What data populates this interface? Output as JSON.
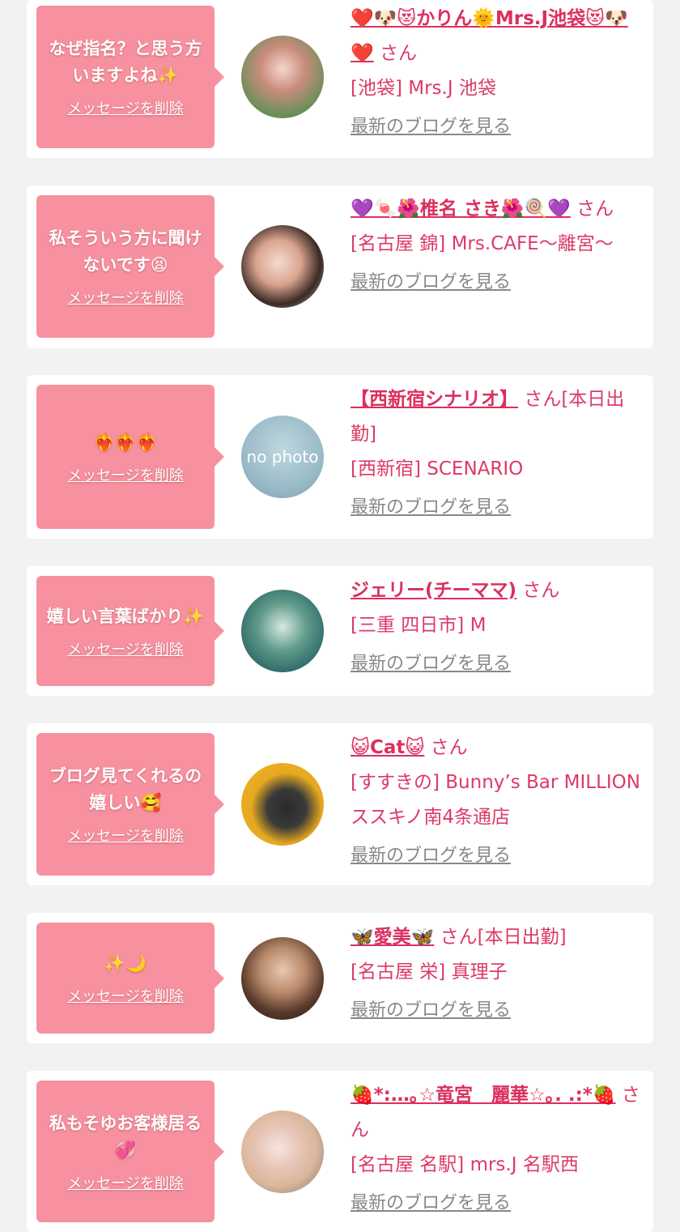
{
  "cards": [
    {
      "message": "なぜ指名？と思う方いますよね✨",
      "delete_label": "メッセージを削除",
      "name": "❤️🐶😻かりん🌞Mrs.J池袋😻🐶❤️",
      "san": "さん",
      "shop": "[池袋] Mrs.J 池袋",
      "blog_label": "最新のブログを見る"
    },
    {
      "message": "私そういう方に聞けないです😫",
      "delete_label": "メッセージを削除",
      "name": "💜🍬🌺椎名 さき🌺🍭💜",
      "san": "さん",
      "shop": "[名古屋 錦] Mrs.CAFE〜離宮〜",
      "blog_label": "最新のブログを見る"
    },
    {
      "message": "❤️‍🔥❤️‍🔥❤️‍🔥",
      "delete_label": "メッセージを削除",
      "name": "【西新宿シナリオ】",
      "san": "さん[本日出勤]",
      "shop": "[西新宿] SCENARIO",
      "blog_label": "最新のブログを見る",
      "avatar_text": "no photo"
    },
    {
      "message": "嬉しい言葉ばかり✨",
      "delete_label": "メッセージを削除",
      "name": "ジェリー(チーママ)",
      "san": "さん",
      "shop": "[三重 四日市] M",
      "blog_label": "最新のブログを見る"
    },
    {
      "message": "ブログ見てくれるの嬉しい🥰",
      "delete_label": "メッセージを削除",
      "name": "😺Cat😺",
      "san": "さん",
      "shop": "[すすきの] Bunny’s Bar MILLION ススキノ南4条通店",
      "blog_label": "最新のブログを見る"
    },
    {
      "message": "✨🌙",
      "delete_label": "メッセージを削除",
      "name": "🦋愛美🦋",
      "san": "さん[本日出勤]",
      "shop": "[名古屋 栄] 真理子",
      "blog_label": "最新のブログを見る"
    },
    {
      "message": "私もそゆお客様居る💞",
      "delete_label": "メッセージを削除",
      "name": "🍓*:…｡☆竜宮　麗華☆｡. .:*🍓",
      "san": "さん",
      "shop": "[名古屋 名駅] mrs.J 名駅西",
      "blog_label": "最新のブログを見る"
    }
  ],
  "colors": {
    "background": "#f2f2f2",
    "bubble": "#f7919f",
    "accent_text": "#dc3a66",
    "link_gray": "#888888"
  }
}
